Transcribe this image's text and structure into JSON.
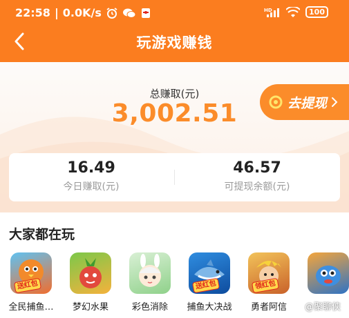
{
  "status_bar": {
    "time": "22:58",
    "network_speed": "0.0K/s",
    "battery": "100",
    "signal_label": "HD"
  },
  "nav": {
    "title": "玩游戏赚钱"
  },
  "summary": {
    "total_label": "总赚取(元)",
    "total_value": "3,002.51",
    "withdraw_label": "去提现"
  },
  "stats": {
    "today_value": "16.49",
    "today_label": "今日赚取(元)",
    "balance_value": "46.57",
    "balance_label": "可提现余额(元)"
  },
  "games": {
    "section_title": "大家都在玩",
    "items": [
      {
        "name": "全民捕鱼…",
        "badge": "送红包",
        "icon": "chick-fish-icon"
      },
      {
        "name": "梦幻水果",
        "badge": "",
        "icon": "radish-fruit-icon"
      },
      {
        "name": "彩色消除",
        "badge": "",
        "icon": "bunny-girl-icon"
      },
      {
        "name": "捕鱼大决战",
        "badge": "送红包",
        "icon": "shark-icon"
      },
      {
        "name": "勇者阿信",
        "badge": "领红包",
        "icon": "hero-icon"
      },
      {
        "name": "",
        "badge": "",
        "icon": "blue-fish-icon"
      }
    ]
  },
  "watermark": "@聚聊侠",
  "colors": {
    "brand_orange": "#fb7d1f",
    "accent_orange": "#fb8c2a"
  }
}
